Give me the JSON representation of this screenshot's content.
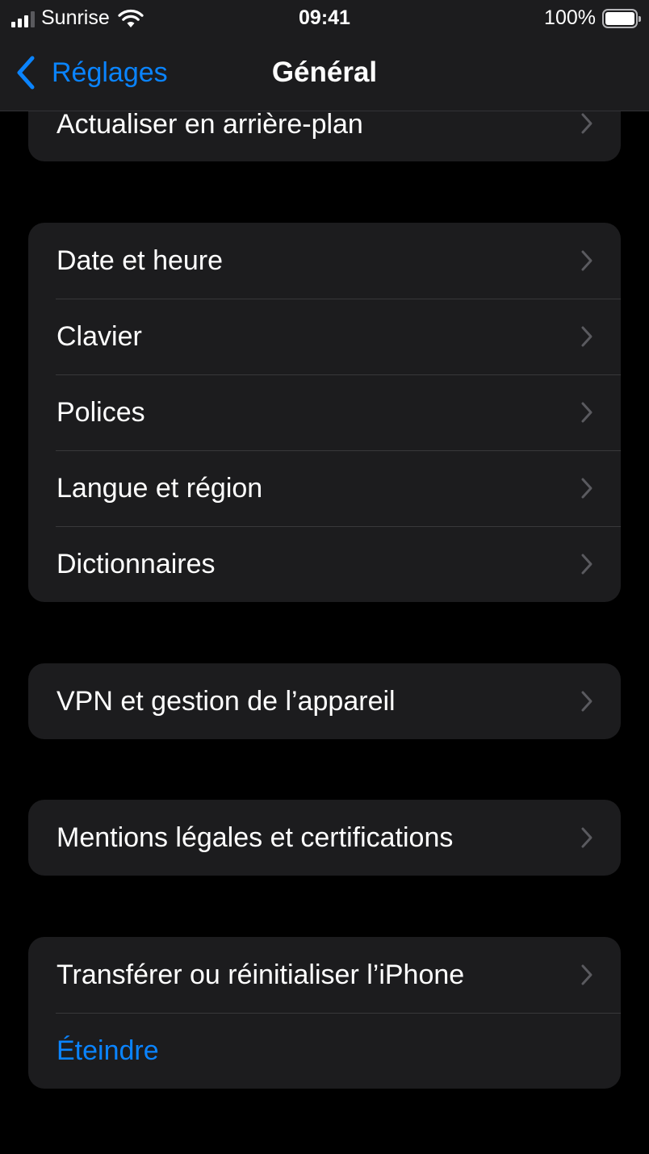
{
  "status_bar": {
    "carrier": "Sunrise",
    "time": "09:41",
    "battery_percent": "100%",
    "signal_bars_filled": 3,
    "signal_bars_total": 4,
    "battery_level": 1.0
  },
  "nav": {
    "back_label": "Réglages",
    "title": "Général"
  },
  "groups": {
    "background": {
      "items": [
        {
          "label": "Actualiser en arrière-plan"
        }
      ]
    },
    "settings": {
      "items": [
        {
          "label": "Date et heure"
        },
        {
          "label": "Clavier"
        },
        {
          "label": "Polices"
        },
        {
          "label": "Langue et région"
        },
        {
          "label": "Dictionnaires"
        }
      ]
    },
    "vpn": {
      "items": [
        {
          "label": "VPN et gestion de l’appareil"
        }
      ]
    },
    "legal": {
      "items": [
        {
          "label": "Mentions légales et certifications"
        }
      ]
    },
    "reset": {
      "items": [
        {
          "label": "Transférer ou réinitialiser l’iPhone"
        },
        {
          "label": "Éteindre"
        }
      ]
    }
  },
  "colors": {
    "accent": "#0a84ff",
    "background": "#000000",
    "cell": "#1c1c1e",
    "separator": "#38383a",
    "chevron": "#5a5a5f"
  }
}
